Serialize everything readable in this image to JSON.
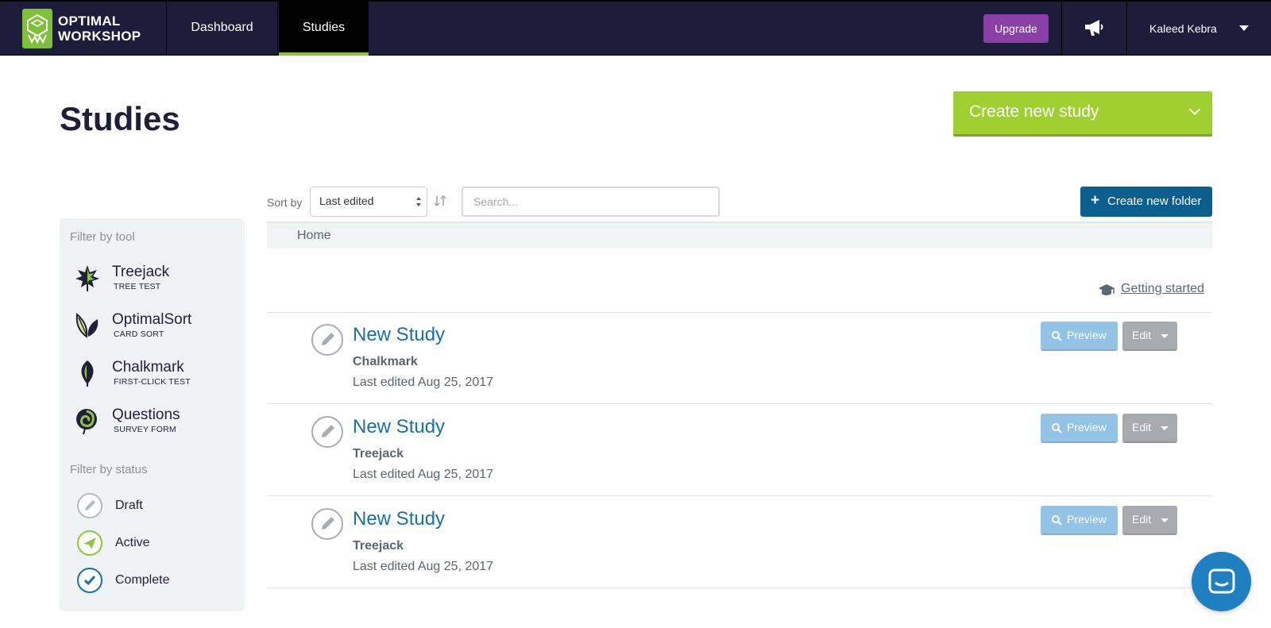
{
  "brand": {
    "line1": "OPTIMAL",
    "line2": "WORKSHOP"
  },
  "nav": {
    "items": [
      {
        "label": "Dashboard",
        "active": false
      },
      {
        "label": "Studies",
        "active": true
      }
    ],
    "upgrade_label": "Upgrade",
    "user_name": "Kaleed Kebra"
  },
  "page": {
    "title": "Studies",
    "create_study_label": "Create new study"
  },
  "sidebar": {
    "tool_heading": "Filter by tool",
    "tools": [
      {
        "name": "Treejack",
        "subtitle": "TREE TEST",
        "icon": "treejack-icon"
      },
      {
        "name": "OptimalSort",
        "subtitle": "CARD SORT",
        "icon": "optimalsort-icon"
      },
      {
        "name": "Chalkmark",
        "subtitle": "FIRST-CLICK TEST",
        "icon": "chalkmark-icon"
      },
      {
        "name": "Questions",
        "subtitle": "SURVEY FORM",
        "icon": "questions-icon"
      }
    ],
    "status_heading": "Filter by status",
    "statuses": [
      {
        "label": "Draft",
        "icon": "pencil-icon"
      },
      {
        "label": "Active",
        "icon": "paper-plane-icon"
      },
      {
        "label": "Complete",
        "icon": "check-icon"
      }
    ]
  },
  "toolbar": {
    "sort_label": "Sort by",
    "sort_value": "Last edited",
    "search_placeholder": "Search...",
    "new_folder_label": "Create new folder"
  },
  "breadcrumb": {
    "current": "Home"
  },
  "getting_started_label": "Getting started",
  "studies": [
    {
      "title": "New Study",
      "tool": "Chalkmark",
      "last_edited": "Last edited Aug 25, 2017",
      "preview_label": "Preview",
      "edit_label": "Edit",
      "status": "draft"
    },
    {
      "title": "New Study",
      "tool": "Treejack",
      "last_edited": "Last edited Aug 25, 2017",
      "preview_label": "Preview",
      "edit_label": "Edit",
      "status": "draft"
    },
    {
      "title": "New Study",
      "tool": "Treejack",
      "last_edited": "Last edited Aug 25, 2017",
      "preview_label": "Preview",
      "edit_label": "Edit",
      "status": "draft"
    }
  ],
  "colors": {
    "nav_bg": "#1d1c3a",
    "accent_green": "#9fd02f",
    "upgrade_purple": "#8b3fa8",
    "folder_blue": "#0b5f8d",
    "link_blue": "#1b6fa3",
    "preview_blue": "#93c4e6",
    "edit_gray": "#a7abaf"
  }
}
